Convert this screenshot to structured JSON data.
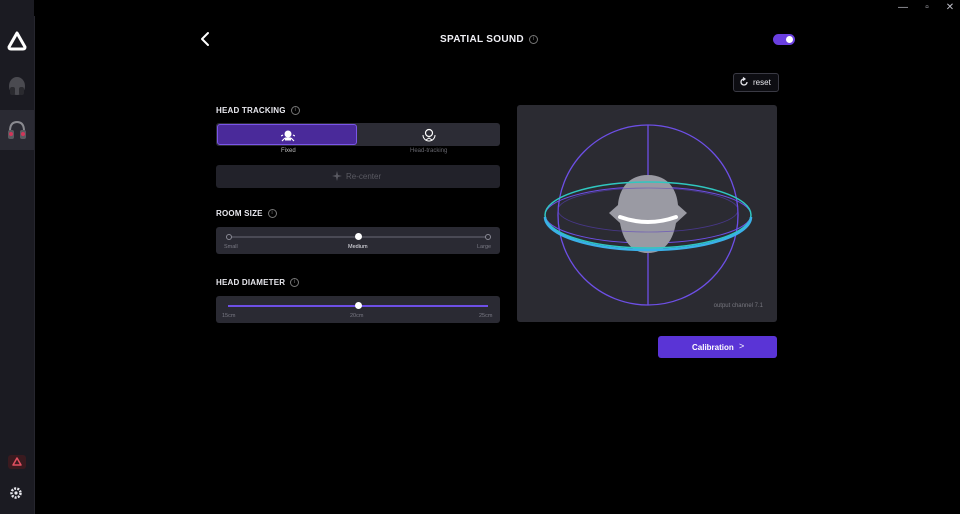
{
  "header": {
    "title": "SPATIAL SOUND",
    "info": "i",
    "spatial_enabled": true
  },
  "window": {
    "min": "—",
    "max": "▫",
    "close": "✕"
  },
  "toolbar": {
    "reset_label": "reset"
  },
  "head_tracking": {
    "label": "HEAD TRACKING",
    "options": [
      {
        "label": "Fixed",
        "selected": true,
        "icon": "fixed-head-icon"
      },
      {
        "label": "Head-tracking",
        "selected": false,
        "icon": "head-tracking-icon"
      }
    ],
    "recenter_label": "Re-center"
  },
  "room_size": {
    "label": "ROOM SIZE",
    "ticks": [
      "Small",
      "Medium",
      "Large"
    ],
    "selected_index": 1
  },
  "head_diameter": {
    "label": "HEAD DIAMETER",
    "ticks": [
      "15cm",
      "20cm",
      "25cm"
    ],
    "value_fraction": 0.5
  },
  "visualization": {
    "caption": "output channel 7.1"
  },
  "calibration": {
    "label": "Calibration",
    "arrow": ">"
  },
  "colors": {
    "accent": "#6d4fe6",
    "teal": "#2fc7c0"
  }
}
